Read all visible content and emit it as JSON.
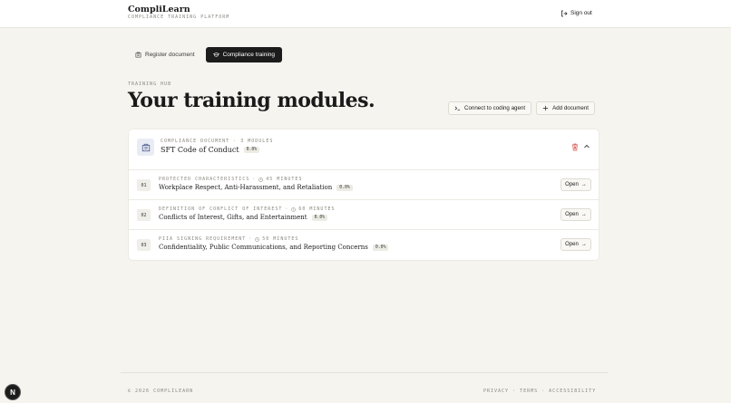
{
  "header": {
    "brand_name": "CompliLearn",
    "brand_tagline": "COMPLIANCE TRAINING PLATFORM",
    "sign_out_label": "Sign out"
  },
  "tabs": [
    {
      "label": "Register document",
      "icon": "building-icon",
      "active": false
    },
    {
      "label": "Compliance training",
      "icon": "graduation-cap-icon",
      "active": true
    }
  ],
  "hero": {
    "eyebrow": "TRAINING HUB",
    "title": "Your training modules.",
    "connect_label": "Connect to coding agent",
    "add_label": "Add document"
  },
  "document": {
    "meta_type": "COMPLIANCE DOCUMENT",
    "meta_count": "3 MODULES",
    "title": "SFT Code of Conduct",
    "progress": "0.0%",
    "icon": "building-icon"
  },
  "modules": [
    {
      "number": "01",
      "tag": "PROTECTED CHARACTERISTICS",
      "duration": "45 MINUTES",
      "title": "Workplace Respect, Anti-Harassment, and Retaliation",
      "progress": "0.0%",
      "open_label": "Open"
    },
    {
      "number": "02",
      "tag": "DEFINITION OF CONFLICT OF INTEREST",
      "duration": "60 MINUTES",
      "title": "Conflicts of Interest, Gifts, and Entertainment",
      "progress": "0.0%",
      "open_label": "Open"
    },
    {
      "number": "03",
      "tag": "PIIA SIGNING REQUIREMENT",
      "duration": "50 MINUTES",
      "title": "Confidentiality, Public Communications, and Reporting Concerns",
      "progress": "0.0%",
      "open_label": "Open"
    }
  ],
  "footer": {
    "copyright": "© 2026 COMPLILEARN",
    "links": [
      "PRIVACY",
      "TERMS",
      "ACCESSIBILITY"
    ],
    "separator": "·"
  },
  "dev_badge": "N",
  "colors": {
    "background": "#f5f4ef",
    "active_tab": "#1c1c1c",
    "danger": "#d9534f",
    "muted": "#8a877e"
  }
}
